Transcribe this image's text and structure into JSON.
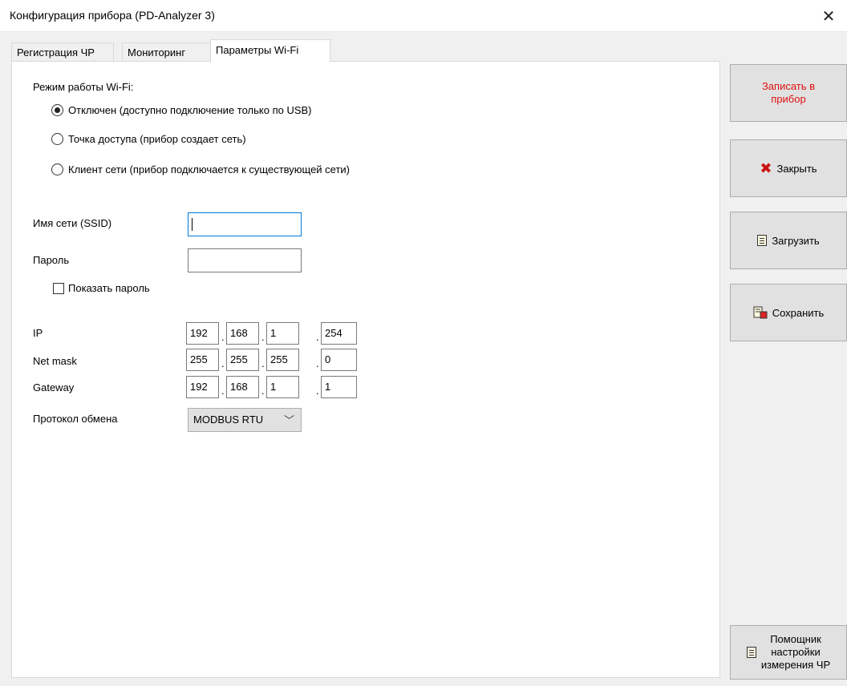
{
  "window": {
    "title": "Конфигурация прибора (PD-Analyzer 3)",
    "close_glyph": "✕"
  },
  "tabs": [
    {
      "label": "Регистрация ЧР",
      "active": false
    },
    {
      "label": "Мониторинг",
      "active": false
    },
    {
      "label": "Параметры Wi-Fi",
      "active": true
    }
  ],
  "wifi": {
    "mode_label": "Режим работы Wi-Fi:",
    "modes": [
      {
        "label": "Отключен (доступно подключение только по USB)",
        "checked": true
      },
      {
        "label": "Точка доступа (прибор создает сеть)",
        "checked": false
      },
      {
        "label": "Клиент сети (прибор подключается к существующей сети)",
        "checked": false
      }
    ],
    "ssid_label": "Имя сети (SSID)",
    "ssid_value": "",
    "password_label": "Пароль",
    "password_value": "",
    "show_password_label": "Показать пароль",
    "show_password_checked": false,
    "ip_label": "IP",
    "ip": [
      "192",
      "168",
      "1",
      "254"
    ],
    "netmask_label": "Net mask",
    "netmask": [
      "255",
      "255",
      "255",
      "0"
    ],
    "gateway_label": "Gateway",
    "gateway": [
      "192",
      "168",
      "1",
      "1"
    ],
    "dot": ".",
    "protocol_label": "Протокол обмена",
    "protocol_value": "MODBUS RTU",
    "chevron_glyph": "﹀"
  },
  "buttons": {
    "write_line1": "Записать в",
    "write_line2": "прибор",
    "close_label": "Закрыть",
    "close_icon_glyph": "✖",
    "load_label": "Загрузить",
    "save_label": "Сохранить",
    "helper_line1": "Помощник",
    "helper_line2": "настройки",
    "helper_line3": "измерения ЧР"
  },
  "colors": {
    "write_text": "#e01010",
    "close_icon": "#c81010",
    "focus_border": "#0078d7"
  }
}
